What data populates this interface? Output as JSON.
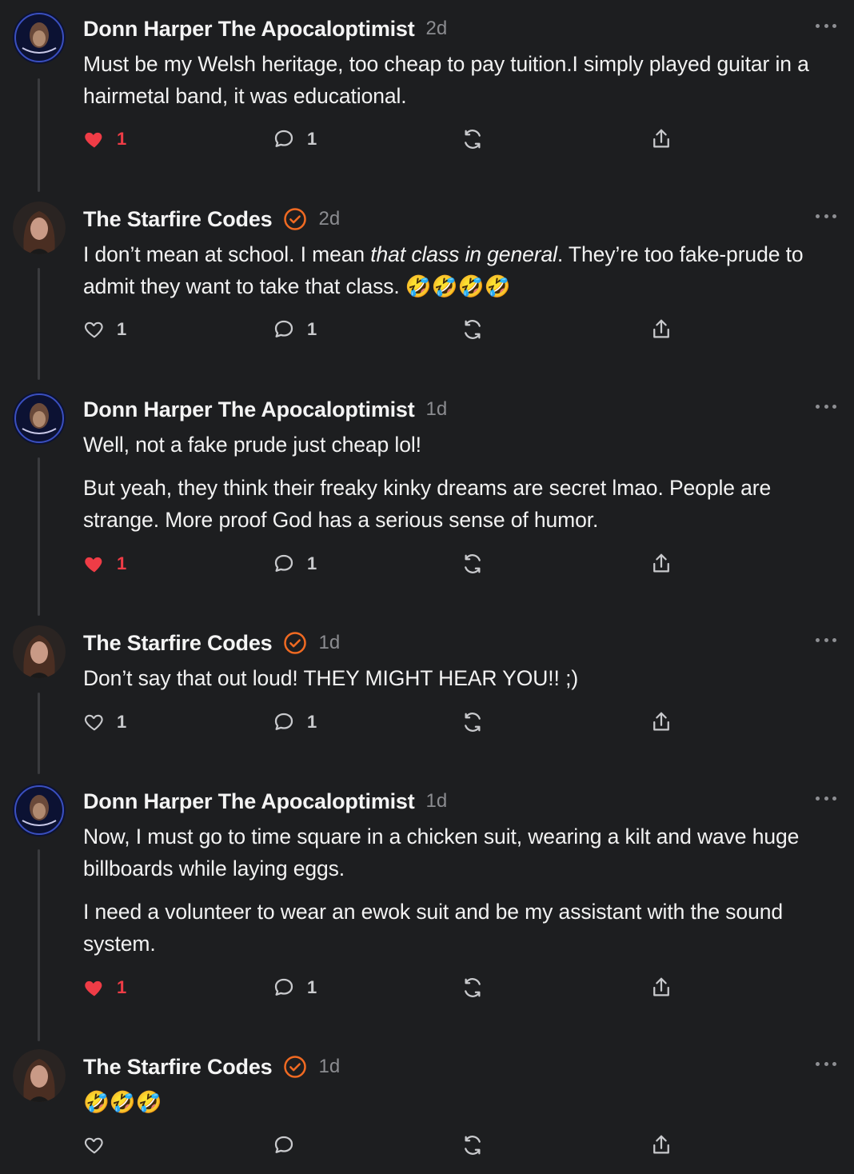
{
  "colors": {
    "background": "#1d1e20",
    "like_active": "#ef3c46",
    "verified": "#f06a22",
    "muted": "#8b8c90"
  },
  "comments": [
    {
      "author": "Donn Harper The Apocaloptimist",
      "verified": false,
      "time": "2d",
      "paragraphs": [
        "Must be my Welsh heritage, too cheap to pay tuition.I simply played guitar in a hairmetal band, it was educational."
      ],
      "likes": "1",
      "liked": true,
      "replies": "1",
      "avatar_icon": "donn-harper-avatar"
    },
    {
      "author": "The Starfire Codes",
      "verified": true,
      "time": "2d",
      "p1_before": "I don’t mean at school. I mean ",
      "p1_em": "that class in general",
      "p1_after": ". They’re too fake-prude to admit they want to take that class. 🤣🤣🤣🤣",
      "likes": "1",
      "liked": false,
      "replies": "1",
      "avatar_icon": "starfire-codes-avatar"
    },
    {
      "author": "Donn Harper The Apocaloptimist",
      "verified": false,
      "time": "1d",
      "paragraphs": [
        "Well, not a fake prude just cheap lol!",
        "But yeah, they think their freaky kinky dreams are secret lmao. People are strange. More proof God has a serious sense of humor."
      ],
      "likes": "1",
      "liked": true,
      "replies": "1",
      "avatar_icon": "donn-harper-avatar"
    },
    {
      "author": "The Starfire Codes",
      "verified": true,
      "time": "1d",
      "paragraphs": [
        "Don’t say that out loud! THEY MIGHT HEAR YOU!! ;)"
      ],
      "likes": "1",
      "liked": false,
      "replies": "1",
      "avatar_icon": "starfire-codes-avatar"
    },
    {
      "author": "Donn Harper The Apocaloptimist",
      "verified": false,
      "time": "1d",
      "paragraphs": [
        "Now, I must go to time square in a chicken suit, wearing a kilt and wave huge billboards while laying eggs.",
        "I need a volunteer to wear an ewok suit and be my assistant with the sound system."
      ],
      "likes": "1",
      "liked": true,
      "replies": "1",
      "avatar_icon": "donn-harper-avatar"
    },
    {
      "author": "The Starfire Codes",
      "verified": true,
      "time": "1d",
      "paragraphs": [
        "🤣🤣🤣"
      ],
      "likes": "",
      "liked": false,
      "replies": "",
      "avatar_icon": "starfire-codes-avatar"
    }
  ]
}
